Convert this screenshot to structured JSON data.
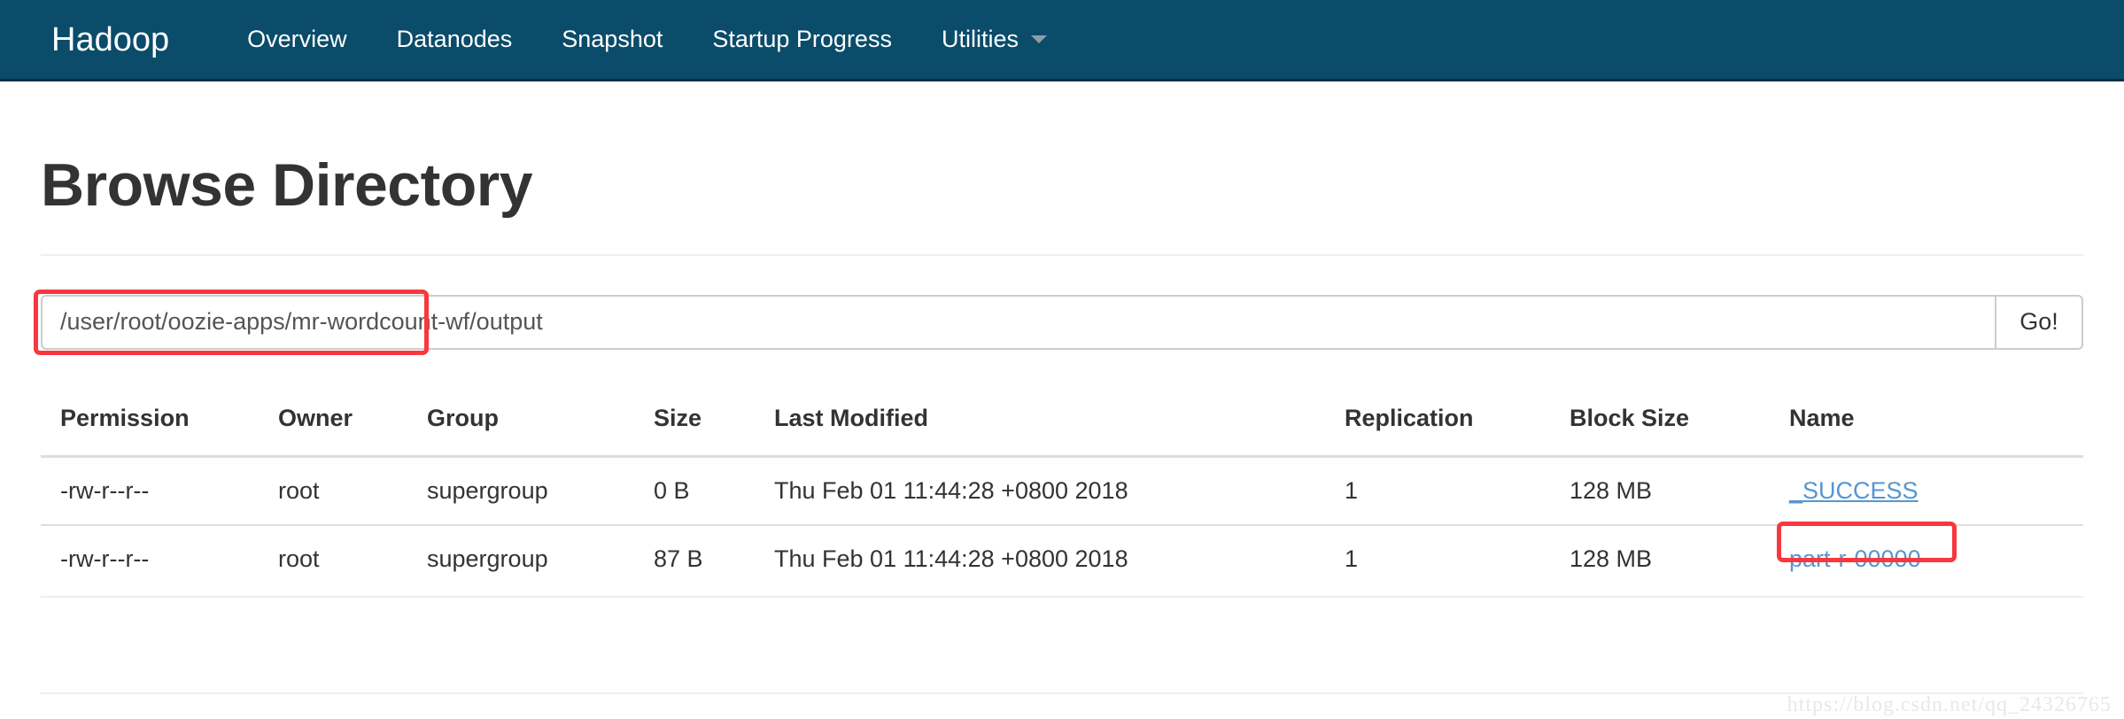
{
  "navbar": {
    "brand": "Hadoop",
    "background_color": "#0a4c6a",
    "items": [
      {
        "label": "Overview",
        "has_caret": false
      },
      {
        "label": "Datanodes",
        "has_caret": false
      },
      {
        "label": "Snapshot",
        "has_caret": false
      },
      {
        "label": "Startup Progress",
        "has_caret": false
      },
      {
        "label": "Utilities",
        "has_caret": true
      }
    ]
  },
  "page": {
    "title": "Browse Directory"
  },
  "path_bar": {
    "value": "/user/root/oozie-apps/mr-wordcount-wf/output",
    "placeholder": "Enter a path",
    "go_label": "Go!",
    "annotation_color": "#f8373f"
  },
  "table": {
    "headers": [
      "Permission",
      "Owner",
      "Group",
      "Size",
      "Last Modified",
      "Replication",
      "Block Size",
      "Name"
    ],
    "rows": [
      {
        "permission": "-rw-r--r--",
        "owner": "root",
        "group": "supergroup",
        "size": "0 B",
        "last_modified": "Thu Feb 01 11:44:28 +0800 2018",
        "replication": "1",
        "block_size": "128 MB",
        "name": "_SUCCESS",
        "name_link_color": "#5596d0",
        "name_annotated": false
      },
      {
        "permission": "-rw-r--r--",
        "owner": "root",
        "group": "supergroup",
        "size": "87 B",
        "last_modified": "Thu Feb 01 11:44:28 +0800 2018",
        "replication": "1",
        "block_size": "128 MB",
        "name": "part-r-00000",
        "name_link_color": "#5596d0",
        "name_annotated": true
      }
    ]
  },
  "watermark": {
    "text": "https://blog.csdn.net/qq_24326765"
  }
}
